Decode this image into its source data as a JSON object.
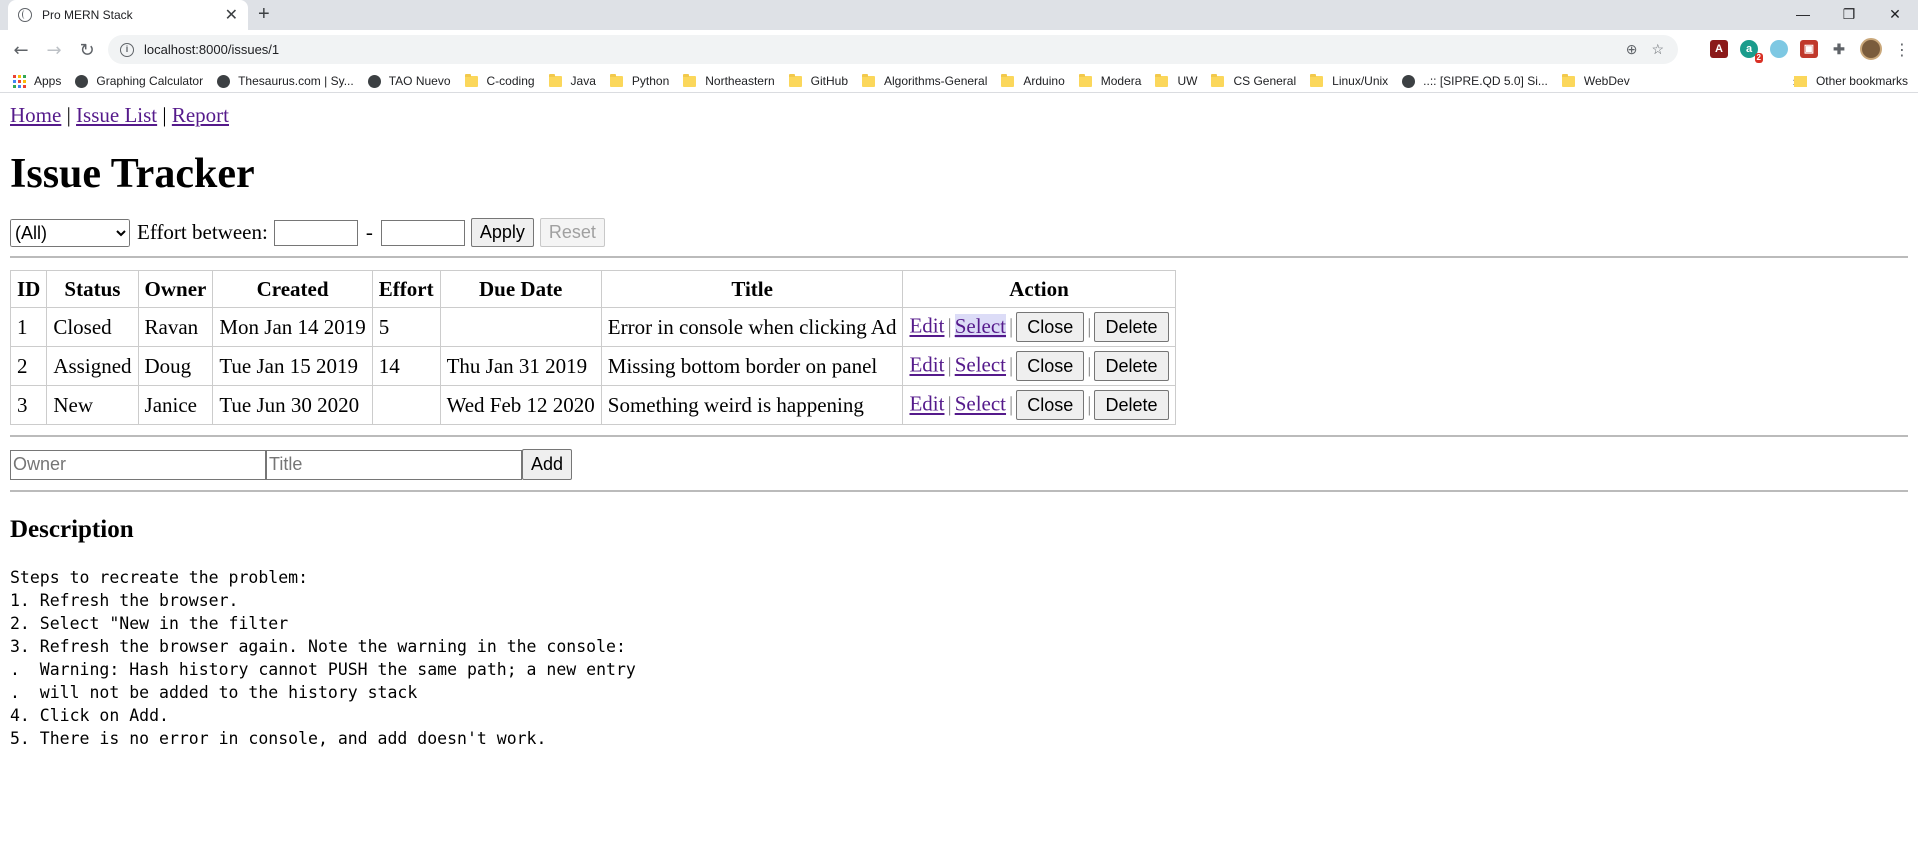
{
  "browser": {
    "tab_title": "Pro MERN Stack",
    "url": "localhost:8000/issues/1",
    "bookmarks": [
      {
        "label": "Apps",
        "icon": "apps-icon"
      },
      {
        "label": "Graphing Calculator",
        "icon": "globe-icon"
      },
      {
        "label": "Thesaurus.com | Sy...",
        "icon": "globe-icon"
      },
      {
        "label": "TAO Nuevo",
        "icon": "globe-icon"
      },
      {
        "label": "C-coding",
        "icon": "folder-icon"
      },
      {
        "label": "Java",
        "icon": "folder-icon"
      },
      {
        "label": "Python",
        "icon": "folder-icon"
      },
      {
        "label": "Northeastern",
        "icon": "folder-icon"
      },
      {
        "label": "GitHub",
        "icon": "folder-icon"
      },
      {
        "label": "Algorithms-General",
        "icon": "folder-icon"
      },
      {
        "label": "Arduino",
        "icon": "folder-icon"
      },
      {
        "label": "Modera",
        "icon": "folder-icon"
      },
      {
        "label": "UW",
        "icon": "folder-icon"
      },
      {
        "label": "CS General",
        "icon": "folder-icon"
      },
      {
        "label": "Linux/Unix",
        "icon": "folder-icon"
      },
      {
        "label": "..:: [SIPRE.QD 5.0] Si...",
        "icon": "globe-icon"
      },
      {
        "label": "WebDev",
        "icon": "folder-icon"
      }
    ],
    "bookmarks_more": "»",
    "other_bookmarks": "Other bookmarks",
    "ext_badge": "2"
  },
  "nav": {
    "home": "Home",
    "issue_list": "Issue List",
    "report": "Report",
    "sep": "|"
  },
  "heading": "Issue Tracker",
  "filter": {
    "status_selected": "(All)",
    "effort_label": "Effort between:",
    "dash": "-",
    "apply": "Apply",
    "reset": "Reset"
  },
  "table": {
    "headers": [
      "ID",
      "Status",
      "Owner",
      "Created",
      "Effort",
      "Due Date",
      "Title",
      "Action"
    ],
    "rows": [
      {
        "id": "1",
        "status": "Closed",
        "owner": "Ravan",
        "created": "Mon Jan 14 2019",
        "effort": "5",
        "due": "",
        "title": "Error in console when clicking Ad"
      },
      {
        "id": "2",
        "status": "Assigned",
        "owner": "Doug",
        "created": "Tue Jan 15 2019",
        "effort": "14",
        "due": "Thu Jan 31 2019",
        "title": "Missing bottom border on panel"
      },
      {
        "id": "3",
        "status": "New",
        "owner": "Janice",
        "created": "Tue Jun 30 2020",
        "effort": "",
        "due": "Wed Feb 12 2020",
        "title": "Something weird is happening"
      }
    ],
    "actions": {
      "edit": "Edit",
      "select": "Select",
      "close": "Close",
      "delete": "Delete",
      "sep": "|"
    }
  },
  "add_form": {
    "owner_placeholder": "Owner",
    "title_placeholder": "Title",
    "add": "Add"
  },
  "description": {
    "heading": "Description",
    "text": "Steps to recreate the problem:\n1. Refresh the browser.\n2. Select \"New in the filter\n3. Refresh the browser again. Note the warning in the console:\n.  Warning: Hash history cannot PUSH the same path; a new entry\n.  will not be added to the history stack\n4. Click on Add.\n5. There is no error in console, and add doesn't work."
  }
}
